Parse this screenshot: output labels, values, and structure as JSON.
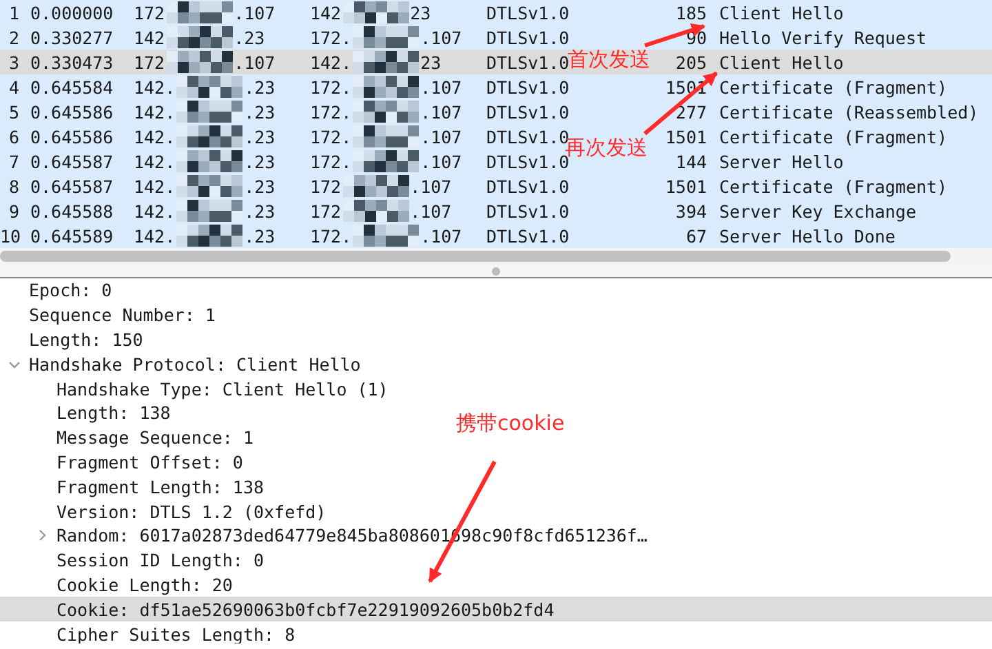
{
  "packets": [
    {
      "no": "1",
      "time": "0.000000",
      "src_start": "172",
      "src_end": ".107",
      "dst_start": "142",
      "dst_end": "23",
      "protocol": "DTLSv1.0",
      "length": "185",
      "info": "Client Hello",
      "selected": false
    },
    {
      "no": "2",
      "time": "0.330277",
      "src_start": "142",
      "src_end": ".23",
      "dst_start": "172.",
      "dst_end": ".107",
      "protocol": "DTLSv1.0",
      "length": "90",
      "info": "Hello Verify Request",
      "selected": false
    },
    {
      "no": "3",
      "time": "0.330473",
      "src_start": "172",
      "src_end": ".107",
      "dst_start": "142.",
      "dst_end": "23",
      "protocol": "DTLSv1.0",
      "length": "205",
      "info": "Client Hello",
      "selected": true
    },
    {
      "no": "4",
      "time": "0.645584",
      "src_start": "142.",
      "src_end": ".23",
      "dst_start": "172.",
      "dst_end": ".107",
      "protocol": "DTLSv1.0",
      "length": "1501",
      "info": "Certificate (Fragment)",
      "selected": false
    },
    {
      "no": "5",
      "time": "0.645586",
      "src_start": "142.",
      "src_end": ".23",
      "dst_start": "172.",
      "dst_end": ".107",
      "protocol": "DTLSv1.0",
      "length": "277",
      "info": "Certificate (Reassembled)",
      "selected": false
    },
    {
      "no": "6",
      "time": "0.645586",
      "src_start": "142.",
      "src_end": ".23",
      "dst_start": "172.",
      "dst_end": ".107",
      "protocol": "DTLSv1.0",
      "length": "1501",
      "info": "Certificate (Fragment)",
      "selected": false
    },
    {
      "no": "7",
      "time": "0.645587",
      "src_start": "142.",
      "src_end": ".23",
      "dst_start": "172.",
      "dst_end": ".107",
      "protocol": "DTLSv1.0",
      "length": "144",
      "info": "Server Hello",
      "selected": false
    },
    {
      "no": "8",
      "time": "0.645587",
      "src_start": "142.",
      "src_end": ".23",
      "dst_start": "172",
      "dst_end": ".107",
      "protocol": "DTLSv1.0",
      "length": "1501",
      "info": "Certificate (Fragment)",
      "selected": false
    },
    {
      "no": "9",
      "time": "0.645588",
      "src_start": "142.",
      "src_end": ".23",
      "dst_start": "172",
      "dst_end": ".107",
      "protocol": "DTLSv1.0",
      "length": "394",
      "info": "Server Key Exchange",
      "selected": false
    },
    {
      "no": "10",
      "time": "0.645589",
      "src_start": "142.",
      "src_end": ".23",
      "dst_start": "172.",
      "dst_end": ".107",
      "protocol": "DTLSv1.0",
      "length": "67",
      "info": "Server Hello Done",
      "selected": false
    }
  ],
  "details": [
    {
      "text": "Epoch: 0",
      "selected": false
    },
    {
      "text": "Sequence Number: 1",
      "selected": false
    },
    {
      "text": "Length: 150",
      "selected": false
    },
    {
      "text": "Handshake Protocol: Client Hello",
      "selected": false,
      "expanded": true,
      "children": [
        {
          "text": "Handshake Type: Client Hello (1)",
          "selected": false
        },
        {
          "text": "Length: 138",
          "selected": false
        },
        {
          "text": "Message Sequence: 1",
          "selected": false
        },
        {
          "text": "Fragment Offset: 0",
          "selected": false
        },
        {
          "text": "Fragment Length: 138",
          "selected": false
        },
        {
          "text": "Version: DTLS 1.2 (0xfefd)",
          "selected": false
        },
        {
          "text": "Random: 6017a02873ded64779e845ba808601698c90f8cfd651236f…",
          "selected": false,
          "expanded": false
        },
        {
          "text": "Session ID Length: 0",
          "selected": false
        },
        {
          "text": "Cookie Length: 20",
          "selected": false
        },
        {
          "text": "Cookie: df51ae52690063b0fcbf7e22919092605b0b2fd4",
          "selected": true
        },
        {
          "text": "Cipher Suites Length: 8",
          "selected": false
        }
      ]
    }
  ],
  "annotations": [
    {
      "text": "首次发送"
    },
    {
      "text": "再次发送"
    },
    {
      "text": "携带cookie"
    }
  ]
}
